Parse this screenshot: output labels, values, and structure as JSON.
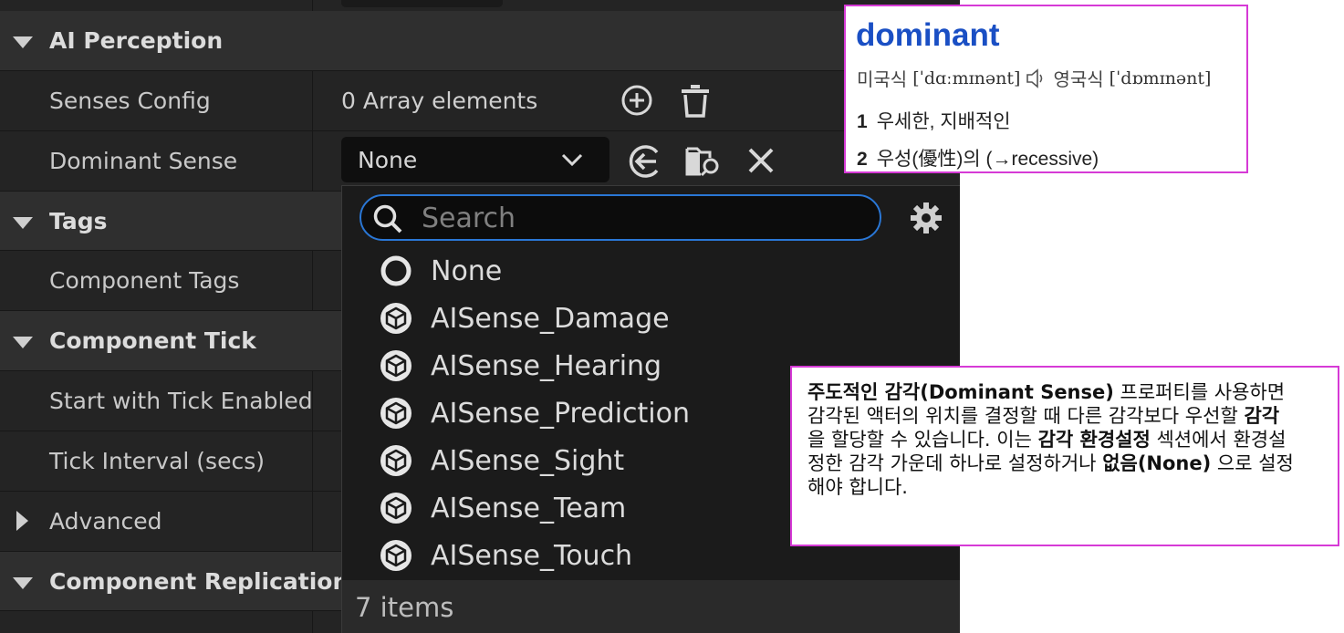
{
  "details_panel": {
    "top_strip": {},
    "categories": {
      "ai_perception": "AI Perception",
      "tags": "Tags",
      "component_tick": "Component Tick",
      "advanced": "Advanced",
      "component_replication": "Component Replication"
    },
    "properties": {
      "senses_config": {
        "label": "Senses Config",
        "value": "0 Array elements"
      },
      "dominant_sense": {
        "label": "Dominant Sense",
        "value": "None"
      },
      "component_tags": {
        "label": "Component Tags"
      },
      "start_with_tick_enabled": {
        "label": "Start with Tick Enabled"
      },
      "tick_interval": {
        "label": "Tick Interval (secs)"
      }
    }
  },
  "dropdown": {
    "search_placeholder": "Search",
    "items": [
      {
        "label": "None",
        "icon": "circle-icon"
      },
      {
        "label": "AISense_Damage",
        "icon": "class-cube-icon"
      },
      {
        "label": "AISense_Hearing",
        "icon": "class-cube-icon"
      },
      {
        "label": "AISense_Prediction",
        "icon": "class-cube-icon"
      },
      {
        "label": "AISense_Sight",
        "icon": "class-cube-icon"
      },
      {
        "label": "AISense_Team",
        "icon": "class-cube-icon"
      },
      {
        "label": "AISense_Touch",
        "icon": "class-cube-icon"
      }
    ],
    "footer": "7 items"
  },
  "dictionary": {
    "word": "dominant",
    "us_label": "미국식",
    "us_ipa": "[ˈdɑːmɪnənt]",
    "uk_label": "영국식",
    "uk_ipa": "[ˈdɒmɪnənt]",
    "def1_num": "1",
    "def1": "우세한, 지배적인",
    "def2_num": "2",
    "def2": "우성(優性)의 (→recessive)"
  },
  "note": {
    "b1": "주도적인 감각(Dominant Sense)",
    "t1": " 프로퍼티를 사용하면 감각된 액터의 위치를 결정할 때 다른 감각보다 우선할 ",
    "b2": "감각",
    "t2": " 을 할당할 수 있습니다. 이는 ",
    "b3": "감각 환경설정",
    "t3": " 섹션에서 환경설정한 감각 가운데 하나로 설정하거나 ",
    "b4": "없음(None)",
    "t4": " 으로 설정해야 합니다."
  },
  "colors": {
    "panel_bg": "#242424",
    "category_bg": "#2f2f2f",
    "accent_blue": "#2a77d6",
    "annotation_border": "#d63ad6",
    "dict_word": "#1a4fc4"
  }
}
